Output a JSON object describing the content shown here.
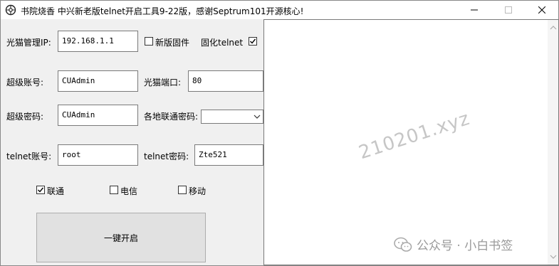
{
  "window": {
    "title": "书院烧香 中兴新老版telnet开启工具9-22版，感谢Septrum101开源核心!"
  },
  "form": {
    "ip_label": "光猫管理IP:",
    "ip_value": "192.168.1.1",
    "new_firmware_label": "新版固件",
    "new_firmware_checked": false,
    "solidify_telnet_label": "固化telnet",
    "solidify_telnet_checked": true,
    "super_account_label": "超级账号:",
    "super_account_value": "CUAdmin",
    "port_label": "光猫端口:",
    "port_value": "80",
    "super_password_label": "超级密码:",
    "super_password_value": "CUAdmin",
    "unicom_password_label": "各地联通密码:",
    "unicom_password_value": "",
    "telnet_account_label": "telnet账号:",
    "telnet_account_value": "root",
    "telnet_password_label": "telnet密码:",
    "telnet_password_value": "Zte521"
  },
  "isp": {
    "unicom_label": "联通",
    "unicom_checked": true,
    "telecom_label": "电信",
    "telecom_checked": false,
    "mobile_label": "移动",
    "mobile_checked": false
  },
  "actions": {
    "start_label": "一键开启"
  },
  "overlay": {
    "watermark": "210201.xyz",
    "wechat_brand": "公众号 · 小白书签"
  }
}
